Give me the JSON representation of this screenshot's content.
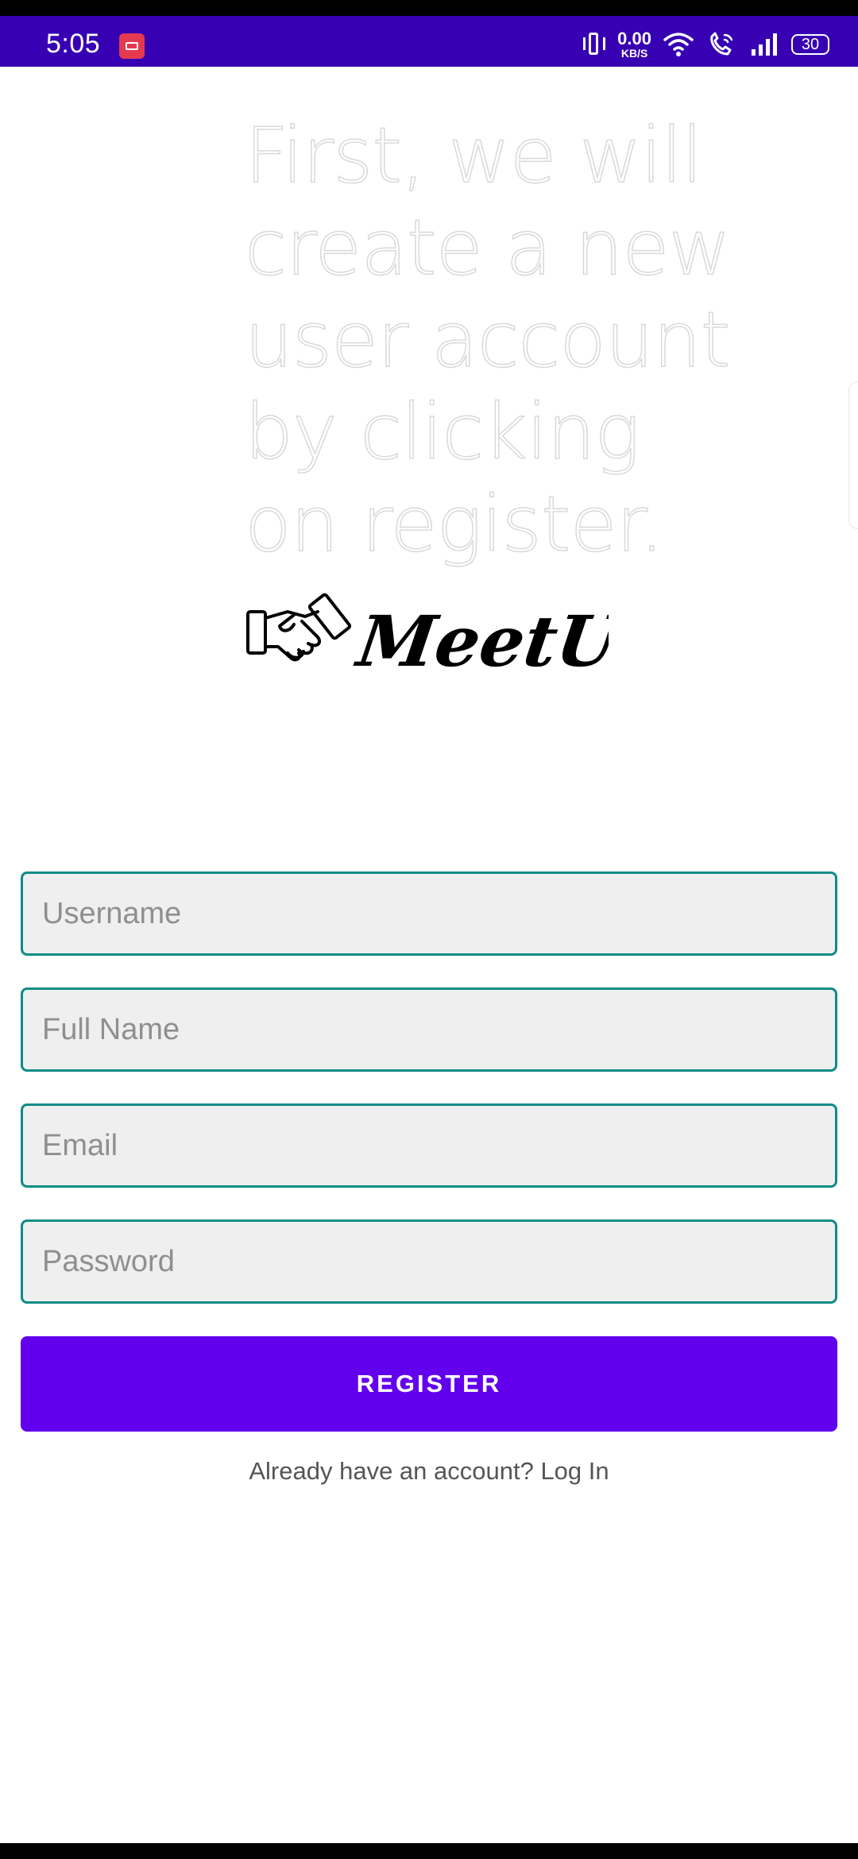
{
  "status_bar": {
    "time": "5:05",
    "net_speed_value": "0.00",
    "net_speed_unit": "KB/S",
    "battery_level": "30"
  },
  "intro": {
    "text": "First, we will create a new user account by clicking on register."
  },
  "logo": {
    "text": "MeetUp",
    "icon": "handshake-icon"
  },
  "form": {
    "username_placeholder": "Username",
    "fullname_placeholder": "Full Name",
    "email_placeholder": "Email",
    "password_placeholder": "Password",
    "register_label": "REGISTER",
    "login_prompt": "Already have an account? Log In"
  },
  "colors": {
    "status_bar": "#3700b3",
    "accent": "#6200ee",
    "field_border": "#0e8c86",
    "field_bg": "#efefef"
  }
}
